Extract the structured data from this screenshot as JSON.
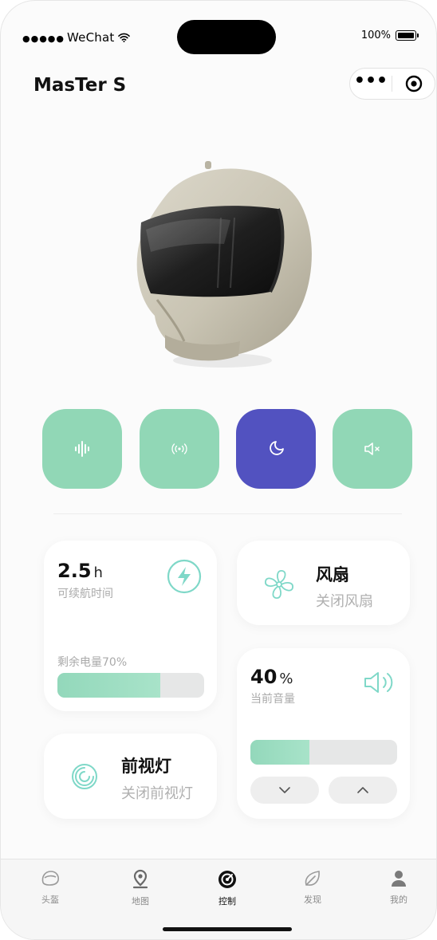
{
  "status_bar": {
    "carrier": "WeChat",
    "battery": "100%"
  },
  "header": {
    "title": "MasTer S"
  },
  "quick_buttons": [
    {
      "icon": "voice-wave-icon",
      "active": false
    },
    {
      "icon": "radio-signal-icon",
      "active": false
    },
    {
      "icon": "moon-icon",
      "active": true
    },
    {
      "icon": "mute-icon",
      "active": false
    }
  ],
  "battery_card": {
    "value": "2.5",
    "unit": "h",
    "label": "可续航时间",
    "remaining_label": "剩余电量70%",
    "remaining_percent": 70,
    "icon": "lightning-icon"
  },
  "fan_card": {
    "title": "风扇",
    "status": "关闭风扇",
    "icon": "fan-icon"
  },
  "volume_card": {
    "value": "40",
    "unit": "%",
    "label": "当前音量",
    "level_percent": 40,
    "icon": "speaker-icon"
  },
  "headlight_card": {
    "title": "前视灯",
    "status": "关闭前视灯",
    "icon": "headlight-icon"
  },
  "tabs": [
    {
      "label": "头盔",
      "icon": "helmet-tab-icon",
      "active": false
    },
    {
      "label": "地图",
      "icon": "map-pin-icon",
      "active": false
    },
    {
      "label": "控制",
      "icon": "control-icon",
      "active": true
    },
    {
      "label": "发现",
      "icon": "discover-icon",
      "active": false
    },
    {
      "label": "我的",
      "icon": "profile-icon",
      "active": false
    }
  ],
  "colors": {
    "accent_green": "#91d7b6",
    "active_purple": "#5252c0",
    "icon_teal": "#7fd8c8"
  }
}
